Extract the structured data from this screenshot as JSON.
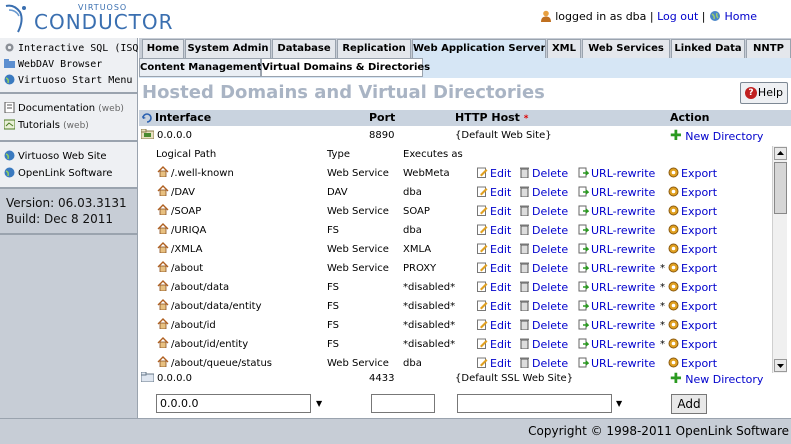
{
  "header": {
    "logo_small": "VIRTUOSO",
    "logo_big": "CONDUCTOR",
    "logged_in_text": "logged in as dba",
    "separator": "|",
    "logout_label": "Log out",
    "home_label": "Home"
  },
  "sidebar": {
    "group1": [
      {
        "label": "Interactive SQL (ISQL)",
        "icon": "gear-icon"
      },
      {
        "label": "WebDAV Browser",
        "icon": "folder-icon"
      },
      {
        "label": "Virtuoso Start Menu",
        "icon": "globe-icon"
      }
    ],
    "group2": [
      {
        "label": "Documentation",
        "sub": "(web)",
        "icon": "document-icon"
      },
      {
        "label": "Tutorials",
        "sub": "(web)",
        "icon": "tutorial-icon"
      }
    ],
    "group3": [
      {
        "label": "Virtuoso Web Site",
        "icon": "globe-icon"
      },
      {
        "label": "OpenLink Software",
        "icon": "globe-icon"
      }
    ],
    "version_line": "Version: 06.03.3131",
    "build_line": "Build: Dec 8 2011"
  },
  "tabs": [
    "Home",
    "System Admin",
    "Database",
    "Replication",
    "Web Application Server",
    "XML",
    "Web Services",
    "Linked Data",
    "NNTP"
  ],
  "subtabs": [
    "Content Management",
    "Virtual Domains & Directories"
  ],
  "main": {
    "title": "Hosted Domains and Virtual Directories",
    "help_label": "Help",
    "columns": {
      "interface": "Interface",
      "port": "Port",
      "http_host": "HTTP Host",
      "required_mark": "*",
      "action": "Action"
    },
    "site1": {
      "interface": "0.0.0.0",
      "port": "8890",
      "host": "{Default Web Site}",
      "action": "New Directory"
    },
    "sub_columns": {
      "path": "Logical Path",
      "type": "Type",
      "executes": "Executes as"
    },
    "action_labels": {
      "edit": "Edit",
      "delete": "Delete",
      "rewrite": "URL-rewrite",
      "export": "Export"
    },
    "directories": [
      {
        "path": "/.well-known",
        "type": "Web Service",
        "exec": "WebMeta",
        "mark": ""
      },
      {
        "path": "/DAV",
        "type": "DAV",
        "exec": "dba",
        "mark": ""
      },
      {
        "path": "/SOAP",
        "type": "Web Service",
        "exec": "SOAP",
        "mark": ""
      },
      {
        "path": "/URIQA",
        "type": "FS",
        "exec": "dba",
        "mark": ""
      },
      {
        "path": "/XMLA",
        "type": "Web Service",
        "exec": "XMLA",
        "mark": ""
      },
      {
        "path": "/about",
        "type": "Web Service",
        "exec": "PROXY",
        "mark": "*"
      },
      {
        "path": "/about/data",
        "type": "FS",
        "exec": "*disabled*",
        "mark": "*"
      },
      {
        "path": "/about/data/entity",
        "type": "FS",
        "exec": "*disabled*",
        "mark": "*"
      },
      {
        "path": "/about/id",
        "type": "FS",
        "exec": "*disabled*",
        "mark": "*"
      },
      {
        "path": "/about/id/entity",
        "type": "FS",
        "exec": "*disabled*",
        "mark": "*"
      },
      {
        "path": "/about/queue/status",
        "type": "Web Service",
        "exec": "dba",
        "mark": ""
      }
    ],
    "site2": {
      "interface": "0.0.0.0",
      "port": "4433",
      "host": "{Default SSL Web Site}",
      "action": "New Directory"
    },
    "new_site": {
      "interface_value": "0.0.0.0",
      "port_value": "",
      "host_value": "",
      "add_label": "Add"
    }
  },
  "footer": {
    "copyright": "Copyright © 1998-2011 OpenLink Software"
  }
}
